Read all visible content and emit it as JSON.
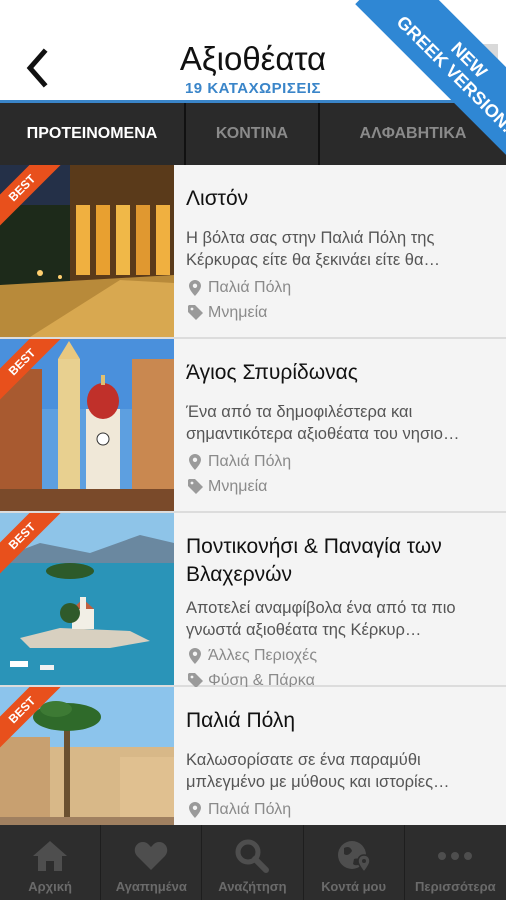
{
  "header": {
    "title": "Αξιοθέατα",
    "subtitle": "19 ΚΑΤΑΧΩΡΙΣΕΙΣ",
    "back_icon": "chevron-left-icon"
  },
  "ribbon": {
    "line1": "NEW",
    "line2": "GREEK VERSION!"
  },
  "tabs": [
    {
      "label": "ΠΡΟΤΕΙΝΟΜΕΝΑ",
      "active": true
    },
    {
      "label": "ΚΟΝΤΙΝΑ",
      "active": false
    },
    {
      "label": "ΑΛΦΑΒΗΤΙΚΑ",
      "active": false
    }
  ],
  "items": [
    {
      "badge": "BEST",
      "title": "Λιστόν",
      "description": "Η βόλτα σας στην Παλιά Πόλη της Κέρκυρας είτε θα ξεκινάει είτε θα…",
      "location": "Παλιά Πόλη",
      "category": "Μνημεία"
    },
    {
      "badge": "BEST",
      "title": "Άγιος Σπυρίδωνας",
      "description": "Ένα από τα δημοφιλέστερα και σημαντικότερα αξιοθέατα του νησιο…",
      "location": "Παλιά Πόλη",
      "category": "Μνημεία"
    },
    {
      "badge": "BEST",
      "title": "Ποντικονήσι & Παναγία των Βλαχερνών",
      "description": "Αποτελεί αναμφίβολα ένα από τα πιο γνωστά αξιοθέατα της Κέρκυρ…",
      "location": "Άλλες Περιοχές",
      "category": "Φύση & Πάρκα"
    },
    {
      "badge": "BEST",
      "title": "Παλιά Πόλη",
      "description": "Καλωσορίσατε σε ένα παραμύθι μπλεγμένο με μύθους και ιστορίες…",
      "location": "Παλιά Πόλη",
      "category": ""
    }
  ],
  "bottom_nav": [
    {
      "label": "Αρχική",
      "icon": "home-icon"
    },
    {
      "label": "Αγαπημένα",
      "icon": "heart-icon"
    },
    {
      "label": "Αναζήτηση",
      "icon": "search-icon"
    },
    {
      "label": "Κοντά μου",
      "icon": "globe-pin-icon"
    },
    {
      "label": "Περισσότερα",
      "icon": "more-dots-icon"
    }
  ],
  "colors": {
    "accent_blue": "#3a85c9",
    "ribbon_blue": "#2f87d4",
    "badge_orange": "#e8501c",
    "tab_bar": "#2a2a2a",
    "nav_bar": "#2d2d2d"
  }
}
